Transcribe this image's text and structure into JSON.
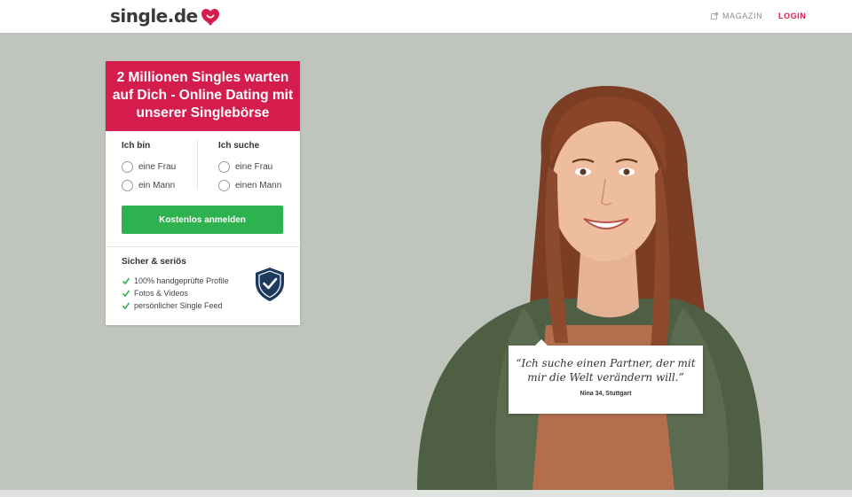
{
  "header": {
    "logo_text": "single.de",
    "magazin_label": "MAGAZIN",
    "login_label": "LOGIN"
  },
  "card": {
    "headline": "2 Millionen Singles warten auf Dich - Online Dating mit unserer Singlebörse",
    "ich_bin": {
      "title": "Ich bin",
      "options": [
        "eine Frau",
        "ein Mann"
      ]
    },
    "ich_suche": {
      "title": "Ich suche",
      "options": [
        "eine Frau",
        "einen Mann"
      ]
    },
    "cta_label": "Kostenlos anmelden",
    "trust": {
      "title": "Sicher & seriös",
      "items": [
        "100% handgeprüfte Profile",
        "Fotos & Videos",
        "persönlicher Single Feed"
      ]
    }
  },
  "testimonial": {
    "quote": "“Ich suche einen Partner, der mit mir die Welt verändern will.”",
    "author": "Nina 34, Stuttgart"
  },
  "colors": {
    "brand": "#d51d4d",
    "cta": "#2eb14f",
    "hero_bg": "#bfc5bd",
    "shield": "#1e3a5f"
  },
  "icons": [
    "heart-logo-icon",
    "external-link-icon",
    "checkmark-icon",
    "shield-check-icon"
  ]
}
